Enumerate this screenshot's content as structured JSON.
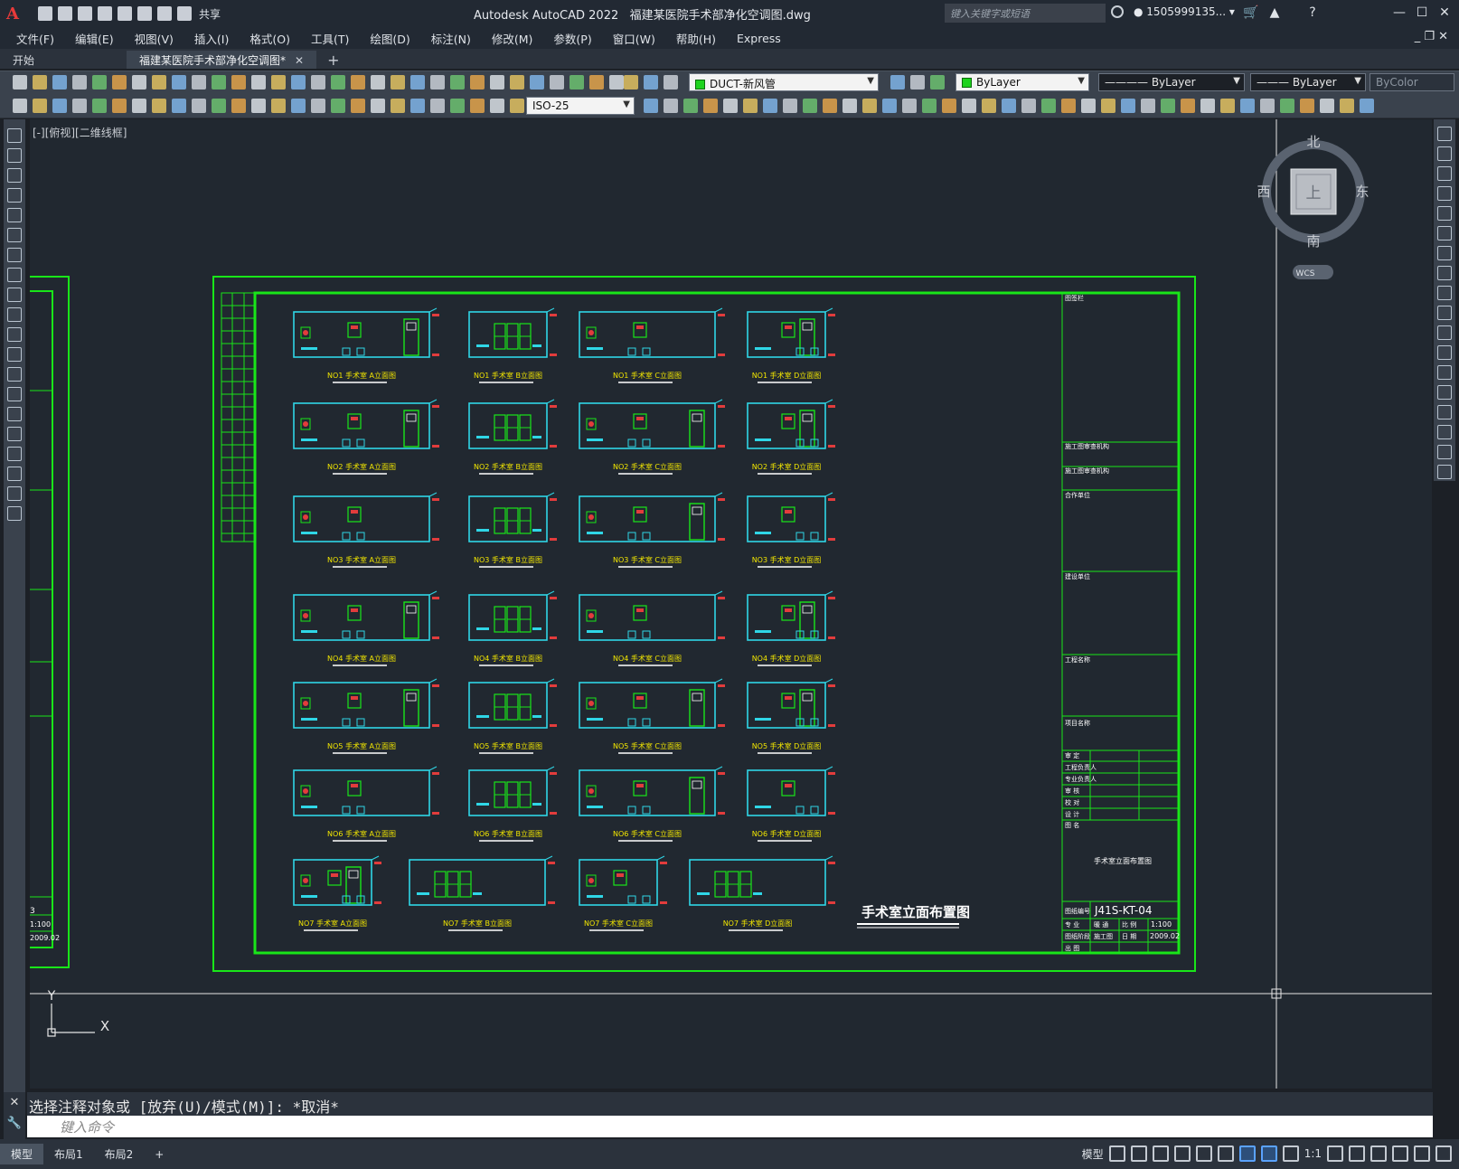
{
  "app": {
    "title": "Autodesk AutoCAD 2022",
    "file": "福建某医院手术部净化空调图.dwg",
    "logo": "A",
    "share": "共享"
  },
  "search": {
    "placeholder": "键入关键字或短语"
  },
  "user": {
    "name": "1505999135..."
  },
  "menus": [
    "文件(F)",
    "编辑(E)",
    "视图(V)",
    "插入(I)",
    "格式(O)",
    "工具(T)",
    "绘图(D)",
    "标注(N)",
    "修改(M)",
    "参数(P)",
    "窗口(W)",
    "帮助(H)",
    "Express"
  ],
  "tabs": [
    {
      "label": "开始"
    },
    {
      "label": "福建某医院手术部净化空调图*"
    }
  ],
  "toolbar": {
    "layer": "DUCT-新风管",
    "color": "ByLayer",
    "linetype": "ByLayer",
    "lineweight": "ByLayer",
    "plotstyle": "ByColor",
    "dimstyle": "ISO-25"
  },
  "view_label": "[-][俯视][二维线框]",
  "viewcube": {
    "north": "北",
    "south": "南",
    "east": "东",
    "west": "西",
    "face": "上",
    "wcs": "WCS"
  },
  "ucs": {
    "x": "X",
    "y": "Y"
  },
  "drawing": {
    "title": "手术室立面布置图",
    "drawing_no": "J41S-KT-04",
    "scale": "1:100",
    "date": "2009.02",
    "block_name": "手术室立面布置图",
    "rows": [
      [
        "NO1 手术室 A立面图",
        "NO1 手术室 B立面图",
        "NO1 手术室 C立面图",
        "NO1 手术室 D立面图"
      ],
      [
        "NO2 手术室 A立面图",
        "NO2 手术室 B立面图",
        "NO2 手术室 C立面图",
        "NO2 手术室 D立面图"
      ],
      [
        "NO3 手术室 A立面图",
        "NO3 手术室 B立面图",
        "NO3 手术室 C立面图",
        "NO3 手术室 D立面图"
      ],
      [
        "NO4 手术室 A立面图",
        "NO4 手术室 B立面图",
        "NO4 手术室 C立面图",
        "NO4 手术室 D立面图"
      ],
      [
        "NO5 手术室 A立面图",
        "NO5 手术室 B立面图",
        "NO5 手术室 C立面图",
        "NO5 手术室 D立面图"
      ],
      [
        "NO6 手术室 A立面图",
        "NO6 手术室 B立面图",
        "NO6 手术室 C立面图",
        "NO6 手术室 D立面图"
      ],
      [
        "NO7 手术室 A立面图",
        "NO7 手术室 B立面图",
        "NO7 手术室 C立面图",
        "NO7 手术室 D立面图"
      ]
    ]
  },
  "command": {
    "history": "选择注释对象或 [放弃(U)/模式(M)]: *取消*",
    "placeholder": "键入命令"
  },
  "layouts": [
    "模型",
    "布局1",
    "布局2"
  ],
  "status": {
    "model": "模型",
    "scale": "1:1"
  }
}
